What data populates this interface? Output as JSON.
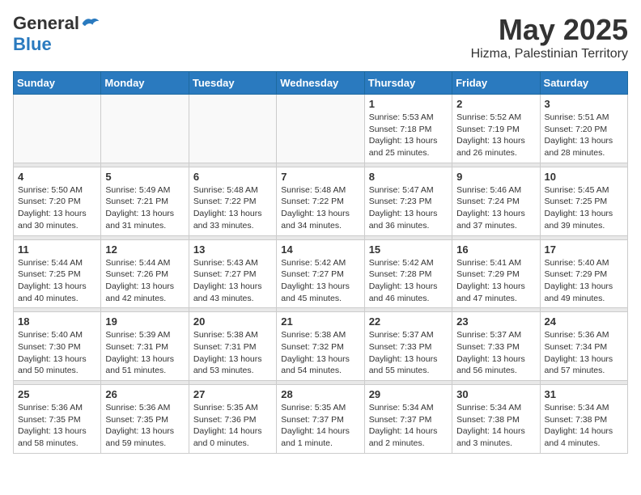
{
  "logo": {
    "general": "General",
    "blue": "Blue"
  },
  "header": {
    "month": "May 2025",
    "location": "Hizma, Palestinian Territory"
  },
  "weekdays": [
    "Sunday",
    "Monday",
    "Tuesday",
    "Wednesday",
    "Thursday",
    "Friday",
    "Saturday"
  ],
  "weeks": [
    [
      {
        "day": "",
        "info": ""
      },
      {
        "day": "",
        "info": ""
      },
      {
        "day": "",
        "info": ""
      },
      {
        "day": "",
        "info": ""
      },
      {
        "day": "1",
        "info": "Sunrise: 5:53 AM\nSunset: 7:18 PM\nDaylight: 13 hours\nand 25 minutes."
      },
      {
        "day": "2",
        "info": "Sunrise: 5:52 AM\nSunset: 7:19 PM\nDaylight: 13 hours\nand 26 minutes."
      },
      {
        "day": "3",
        "info": "Sunrise: 5:51 AM\nSunset: 7:20 PM\nDaylight: 13 hours\nand 28 minutes."
      }
    ],
    [
      {
        "day": "4",
        "info": "Sunrise: 5:50 AM\nSunset: 7:20 PM\nDaylight: 13 hours\nand 30 minutes."
      },
      {
        "day": "5",
        "info": "Sunrise: 5:49 AM\nSunset: 7:21 PM\nDaylight: 13 hours\nand 31 minutes."
      },
      {
        "day": "6",
        "info": "Sunrise: 5:48 AM\nSunset: 7:22 PM\nDaylight: 13 hours\nand 33 minutes."
      },
      {
        "day": "7",
        "info": "Sunrise: 5:48 AM\nSunset: 7:22 PM\nDaylight: 13 hours\nand 34 minutes."
      },
      {
        "day": "8",
        "info": "Sunrise: 5:47 AM\nSunset: 7:23 PM\nDaylight: 13 hours\nand 36 minutes."
      },
      {
        "day": "9",
        "info": "Sunrise: 5:46 AM\nSunset: 7:24 PM\nDaylight: 13 hours\nand 37 minutes."
      },
      {
        "day": "10",
        "info": "Sunrise: 5:45 AM\nSunset: 7:25 PM\nDaylight: 13 hours\nand 39 minutes."
      }
    ],
    [
      {
        "day": "11",
        "info": "Sunrise: 5:44 AM\nSunset: 7:25 PM\nDaylight: 13 hours\nand 40 minutes."
      },
      {
        "day": "12",
        "info": "Sunrise: 5:44 AM\nSunset: 7:26 PM\nDaylight: 13 hours\nand 42 minutes."
      },
      {
        "day": "13",
        "info": "Sunrise: 5:43 AM\nSunset: 7:27 PM\nDaylight: 13 hours\nand 43 minutes."
      },
      {
        "day": "14",
        "info": "Sunrise: 5:42 AM\nSunset: 7:27 PM\nDaylight: 13 hours\nand 45 minutes."
      },
      {
        "day": "15",
        "info": "Sunrise: 5:42 AM\nSunset: 7:28 PM\nDaylight: 13 hours\nand 46 minutes."
      },
      {
        "day": "16",
        "info": "Sunrise: 5:41 AM\nSunset: 7:29 PM\nDaylight: 13 hours\nand 47 minutes."
      },
      {
        "day": "17",
        "info": "Sunrise: 5:40 AM\nSunset: 7:29 PM\nDaylight: 13 hours\nand 49 minutes."
      }
    ],
    [
      {
        "day": "18",
        "info": "Sunrise: 5:40 AM\nSunset: 7:30 PM\nDaylight: 13 hours\nand 50 minutes."
      },
      {
        "day": "19",
        "info": "Sunrise: 5:39 AM\nSunset: 7:31 PM\nDaylight: 13 hours\nand 51 minutes."
      },
      {
        "day": "20",
        "info": "Sunrise: 5:38 AM\nSunset: 7:31 PM\nDaylight: 13 hours\nand 53 minutes."
      },
      {
        "day": "21",
        "info": "Sunrise: 5:38 AM\nSunset: 7:32 PM\nDaylight: 13 hours\nand 54 minutes."
      },
      {
        "day": "22",
        "info": "Sunrise: 5:37 AM\nSunset: 7:33 PM\nDaylight: 13 hours\nand 55 minutes."
      },
      {
        "day": "23",
        "info": "Sunrise: 5:37 AM\nSunset: 7:33 PM\nDaylight: 13 hours\nand 56 minutes."
      },
      {
        "day": "24",
        "info": "Sunrise: 5:36 AM\nSunset: 7:34 PM\nDaylight: 13 hours\nand 57 minutes."
      }
    ],
    [
      {
        "day": "25",
        "info": "Sunrise: 5:36 AM\nSunset: 7:35 PM\nDaylight: 13 hours\nand 58 minutes."
      },
      {
        "day": "26",
        "info": "Sunrise: 5:36 AM\nSunset: 7:35 PM\nDaylight: 13 hours\nand 59 minutes."
      },
      {
        "day": "27",
        "info": "Sunrise: 5:35 AM\nSunset: 7:36 PM\nDaylight: 14 hours\nand 0 minutes."
      },
      {
        "day": "28",
        "info": "Sunrise: 5:35 AM\nSunset: 7:37 PM\nDaylight: 14 hours\nand 1 minute."
      },
      {
        "day": "29",
        "info": "Sunrise: 5:34 AM\nSunset: 7:37 PM\nDaylight: 14 hours\nand 2 minutes."
      },
      {
        "day": "30",
        "info": "Sunrise: 5:34 AM\nSunset: 7:38 PM\nDaylight: 14 hours\nand 3 minutes."
      },
      {
        "day": "31",
        "info": "Sunrise: 5:34 AM\nSunset: 7:38 PM\nDaylight: 14 hours\nand 4 minutes."
      }
    ]
  ]
}
